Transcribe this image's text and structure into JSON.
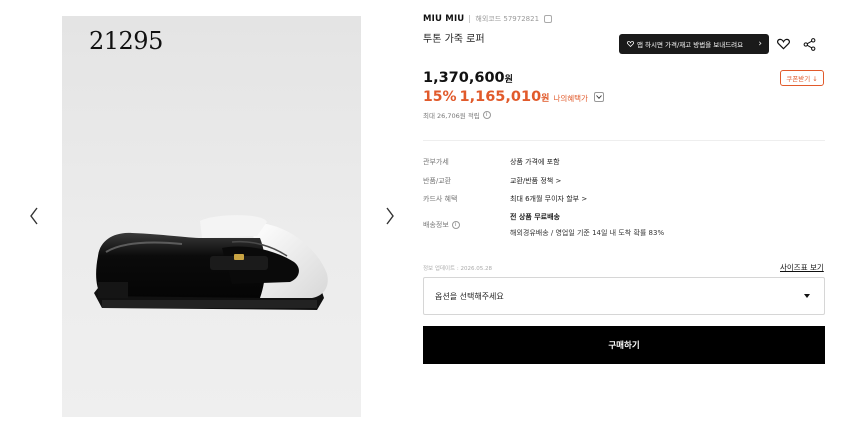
{
  "gallery": {
    "watermark": "21295",
    "prev_icon": "chevron-left-icon",
    "next_icon": "chevron-right-icon",
    "image_icon": "loafer-shoe-illustration"
  },
  "product": {
    "brand": "MIU MIU",
    "code_label": "해외코드 57972821",
    "name": "투톤 가죽 로퍼",
    "notify_label": "앱 하시면 가격/재고 방법을 보내드려요",
    "notify_icon": "heart-icon",
    "wish_icon": "heart-icon",
    "share_icon": "share-icon",
    "price": "1,370,600",
    "price_unit": "원",
    "coupon_label": "쿠폰받기 ↓",
    "discount": "15%",
    "sale_price": "1,165,010",
    "sale_unit": "원",
    "benefit_label": "나의혜택가",
    "points": "최대 26,706원 적립"
  },
  "details": [
    {
      "label": "관부가세",
      "value": "상품 가격에 포함"
    },
    {
      "label": "반품/교환",
      "value": "교환/반품 정책 >"
    },
    {
      "label": "카드사 혜택",
      "value": "최대 6개월 무이자 할부 >"
    },
    {
      "label": "배송정보",
      "value": "전 상품 무료배송",
      "sub": "해외경유배송 / 영업일 기준 14일 내 도착 확률 83%"
    }
  ],
  "arrival_note": "정보 업데이트 : 2026.05.28",
  "size_guide": "사이즈표 보기",
  "option_placeholder": "옵션을 선택해주세요",
  "buy_label": "구매하기",
  "colors": {
    "accent": "#e15a2b",
    "dark": "#1a1a1a"
  }
}
